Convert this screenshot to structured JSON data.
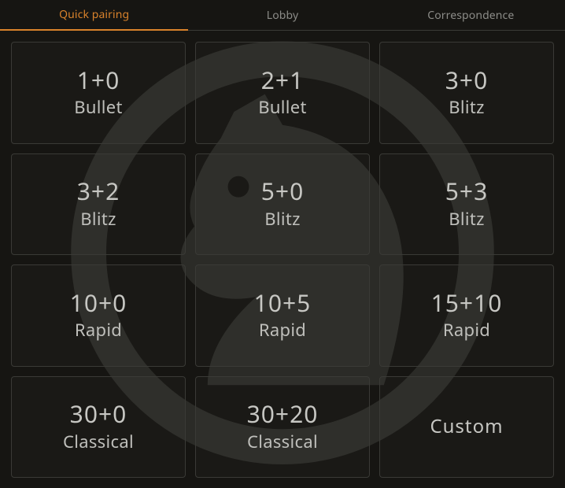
{
  "colors": {
    "accent": "#d9822b",
    "bg": "#161512",
    "tile_border": "#3a3a36",
    "text": "#bababa"
  },
  "tabs": [
    {
      "label": "Quick pairing",
      "active": true
    },
    {
      "label": "Lobby",
      "active": false
    },
    {
      "label": "Correspondence",
      "active": false
    }
  ],
  "tiles": [
    {
      "time": "1+0",
      "cat": "Bullet"
    },
    {
      "time": "2+1",
      "cat": "Bullet"
    },
    {
      "time": "3+0",
      "cat": "Blitz"
    },
    {
      "time": "3+2",
      "cat": "Blitz"
    },
    {
      "time": "5+0",
      "cat": "Blitz"
    },
    {
      "time": "5+3",
      "cat": "Blitz"
    },
    {
      "time": "10+0",
      "cat": "Rapid"
    },
    {
      "time": "10+5",
      "cat": "Rapid"
    },
    {
      "time": "15+10",
      "cat": "Rapid"
    },
    {
      "time": "30+0",
      "cat": "Classical"
    },
    {
      "time": "30+20",
      "cat": "Classical"
    },
    {
      "label": "Custom"
    }
  ]
}
